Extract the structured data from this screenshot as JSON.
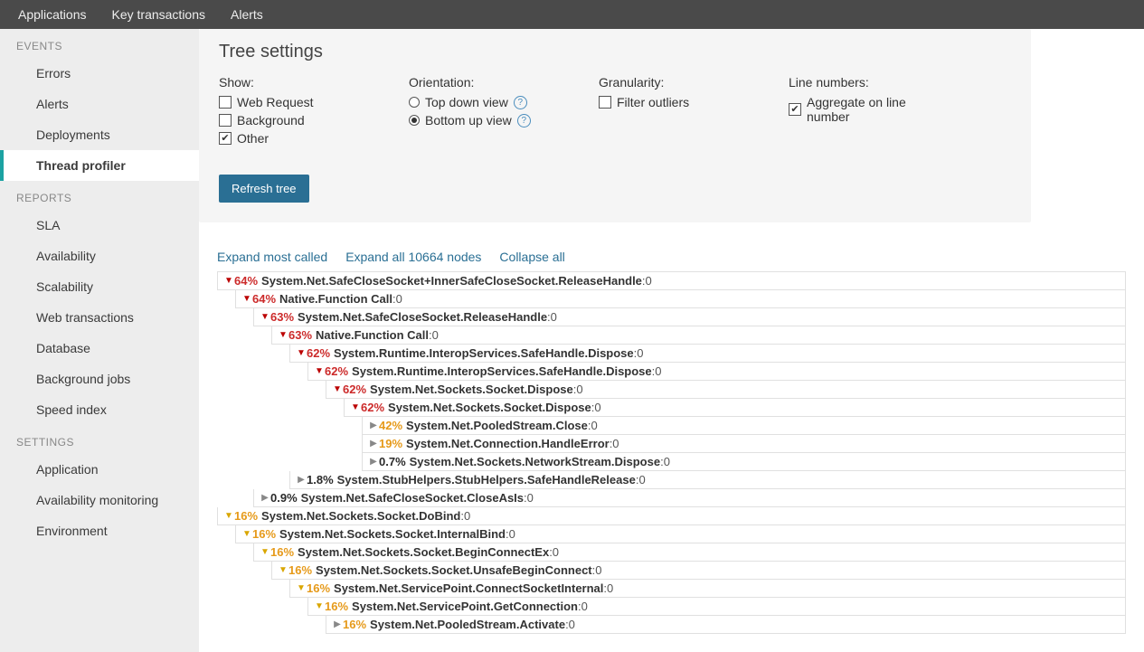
{
  "topnav": {
    "applications": "Applications",
    "keytx": "Key transactions",
    "alerts": "Alerts"
  },
  "sidebar": {
    "events": "EVENTS",
    "events_items": [
      "Errors",
      "Alerts",
      "Deployments",
      "Thread profiler"
    ],
    "reports": "REPORTS",
    "reports_items": [
      "SLA",
      "Availability",
      "Scalability",
      "Web transactions",
      "Database",
      "Background jobs",
      "Speed index"
    ],
    "settings": "SETTINGS",
    "settings_items": [
      "Application",
      "Availability monitoring",
      "Environment"
    ]
  },
  "settings": {
    "title": "Tree settings",
    "show_label": "Show:",
    "show_webreq": "Web Request",
    "show_background": "Background",
    "show_other": "Other",
    "orientation_label": "Orientation:",
    "topdown": "Top down view",
    "bottomup": "Bottom up view",
    "granularity_label": "Granularity:",
    "filter_outliers": "Filter outliers",
    "linenum_label": "Line numbers:",
    "aggregate": "Aggregate on line number",
    "refresh": "Refresh tree"
  },
  "links": {
    "expand_most": "Expand most called",
    "expand_all": "Expand all 10664 nodes",
    "collapse": "Collapse all"
  },
  "tree": [
    {
      "indent": 0,
      "arrow": "open",
      "pct": "64%",
      "pctClass": "red",
      "method": "System.Net.SafeCloseSocket+InnerSafeCloseSocket.ReleaseHandle",
      "ln": ":0"
    },
    {
      "indent": 1,
      "arrow": "open",
      "pct": "64%",
      "pctClass": "red",
      "method": "Native.Function Call",
      "ln": ":0"
    },
    {
      "indent": 2,
      "arrow": "open",
      "pct": "63%",
      "pctClass": "red",
      "method": "System.Net.SafeCloseSocket.ReleaseHandle",
      "ln": ":0"
    },
    {
      "indent": 3,
      "arrow": "open",
      "pct": "63%",
      "pctClass": "red",
      "method": "Native.Function Call",
      "ln": ":0"
    },
    {
      "indent": 4,
      "arrow": "open",
      "pct": "62%",
      "pctClass": "red",
      "method": "System.Runtime.InteropServices.SafeHandle.Dispose",
      "ln": ":0"
    },
    {
      "indent": 5,
      "arrow": "open",
      "pct": "62%",
      "pctClass": "red",
      "method": "System.Runtime.InteropServices.SafeHandle.Dispose",
      "ln": ":0"
    },
    {
      "indent": 6,
      "arrow": "open",
      "pct": "62%",
      "pctClass": "red",
      "method": "System.Net.Sockets.Socket.Dispose",
      "ln": ":0"
    },
    {
      "indent": 7,
      "arrow": "open",
      "pct": "62%",
      "pctClass": "red",
      "method": "System.Net.Sockets.Socket.Dispose",
      "ln": ":0"
    },
    {
      "indent": 8,
      "arrow": "closed",
      "pct": "42%",
      "pctClass": "orange",
      "method": "System.Net.PooledStream.Close",
      "ln": ":0"
    },
    {
      "indent": 8,
      "arrow": "closed",
      "pct": "19%",
      "pctClass": "orange",
      "method": "System.Net.Connection.HandleError",
      "ln": ":0"
    },
    {
      "indent": 8,
      "arrow": "closed",
      "pct": "0.7%",
      "pctClass": "dark",
      "method": "System.Net.Sockets.NetworkStream.Dispose",
      "ln": ":0"
    },
    {
      "indent": 4,
      "arrow": "closed",
      "pct": "1.8%",
      "pctClass": "dark",
      "method": "System.StubHelpers.StubHelpers.SafeHandleRelease",
      "ln": ":0"
    },
    {
      "indent": 2,
      "arrow": "closed",
      "pct": "0.9%",
      "pctClass": "dark",
      "method": "System.Net.SafeCloseSocket.CloseAsIs",
      "ln": ":0"
    },
    {
      "indent": 0,
      "arrow": "open-y",
      "pct": "16%",
      "pctClass": "orange",
      "method": "System.Net.Sockets.Socket.DoBind",
      "ln": ":0"
    },
    {
      "indent": 1,
      "arrow": "open-y",
      "pct": "16%",
      "pctClass": "orange",
      "method": "System.Net.Sockets.Socket.InternalBind",
      "ln": ":0"
    },
    {
      "indent": 2,
      "arrow": "open-y",
      "pct": "16%",
      "pctClass": "orange",
      "method": "System.Net.Sockets.Socket.BeginConnectEx",
      "ln": ":0"
    },
    {
      "indent": 3,
      "arrow": "open-y",
      "pct": "16%",
      "pctClass": "orange",
      "method": "System.Net.Sockets.Socket.UnsafeBeginConnect",
      "ln": ":0"
    },
    {
      "indent": 4,
      "arrow": "open-y",
      "pct": "16%",
      "pctClass": "orange",
      "method": "System.Net.ServicePoint.ConnectSocketInternal",
      "ln": ":0"
    },
    {
      "indent": 5,
      "arrow": "open-y",
      "pct": "16%",
      "pctClass": "orange",
      "method": "System.Net.ServicePoint.GetConnection",
      "ln": ":0"
    },
    {
      "indent": 6,
      "arrow": "closed",
      "pct": "16%",
      "pctClass": "orange",
      "method": "System.Net.PooledStream.Activate",
      "ln": ":0"
    }
  ]
}
